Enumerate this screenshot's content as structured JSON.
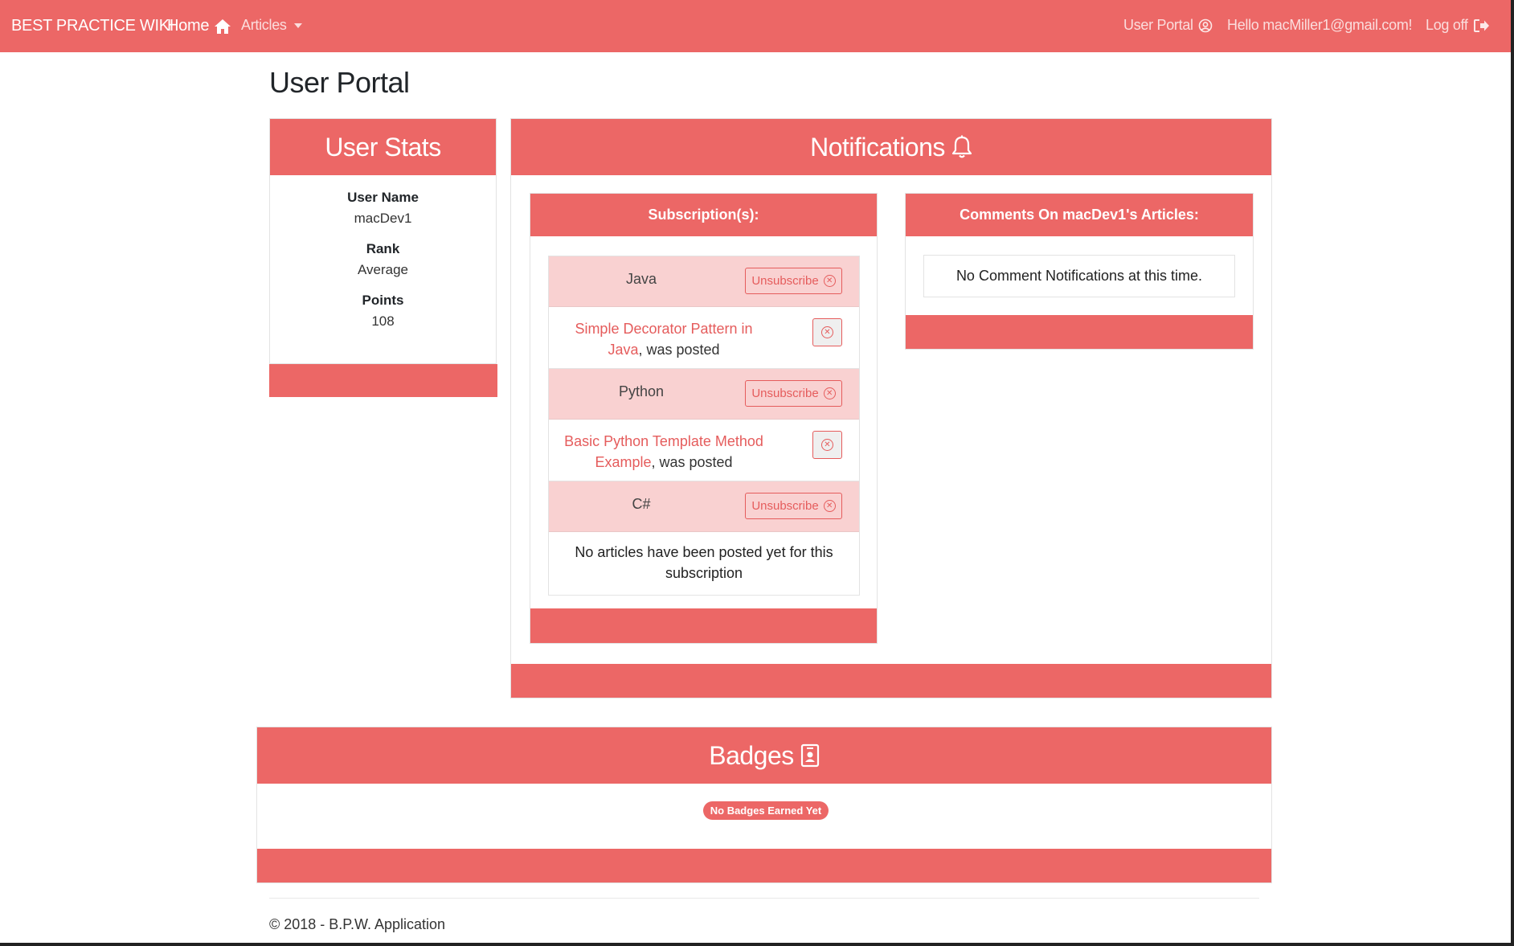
{
  "nav": {
    "brand": "BEST PRACTICE WIKI",
    "home": "Home",
    "articles": "Articles",
    "user_portal": "User Portal",
    "greeting": "Hello macMiller1@gmail.com!",
    "logoff": "Log off",
    "icons": [
      "home-icon",
      "caret-down-icon",
      "user-circle-icon",
      "sign-out-icon"
    ]
  },
  "page": {
    "title": "User Portal"
  },
  "user_stats": {
    "title": "User Stats",
    "items": [
      {
        "label": "User Name",
        "value": "macDev1"
      },
      {
        "label": "Rank",
        "value": "Average"
      },
      {
        "label": "Points",
        "value": "108"
      }
    ]
  },
  "notifications": {
    "title": "Notifications",
    "icon": "bell-icon",
    "subscriptions": {
      "title": "Subscription(s):",
      "unsubscribe_label": "Unsubscribe",
      "topics": [
        {
          "name": "Java",
          "article_link": "Simple Decorator Pattern in Java",
          "article_suffix": ", was posted"
        },
        {
          "name": "Python",
          "article_link": "Basic Python Template Method Example",
          "article_suffix": ", was posted"
        },
        {
          "name": "C#",
          "empty_text": "No articles have been posted yet for this subscription"
        }
      ]
    },
    "comments": {
      "title": "Comments On macDev1's Articles:",
      "empty_text": "No Comment Notifications at this time."
    }
  },
  "badges": {
    "title": "Badges",
    "icon": "id-badge-icon",
    "empty_badge": "No Badges Earned Yet"
  },
  "footer": {
    "text": "© 2018 - B.P.W. Application"
  },
  "colors": {
    "primary": "#ec6766",
    "row_highlight": "#f9d1d1",
    "link": "#e55c5c"
  }
}
